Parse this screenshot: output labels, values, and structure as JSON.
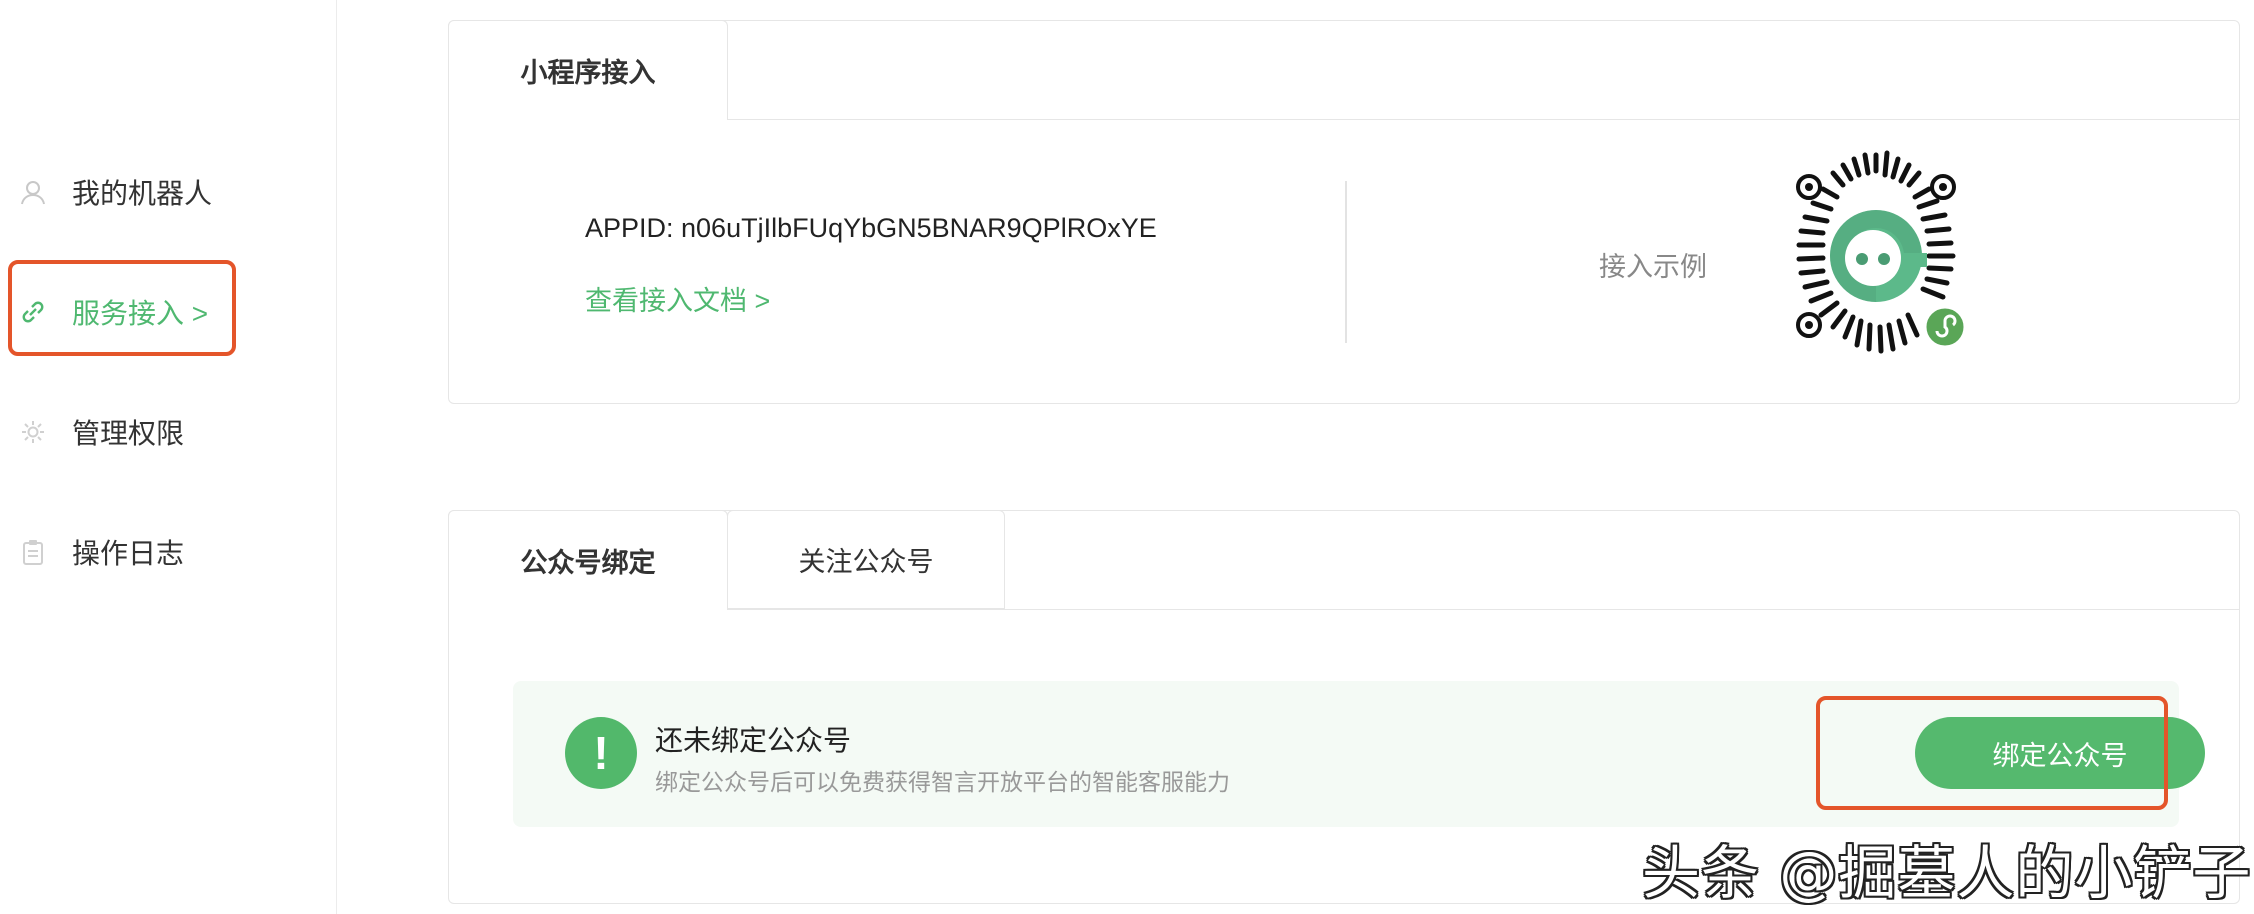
{
  "sidebar": {
    "items": [
      {
        "label": "我的机器人",
        "icon": "user-icon"
      },
      {
        "label": "服务接入 >",
        "icon": "link-icon",
        "active": true
      },
      {
        "label": "管理权限",
        "icon": "gear-icon"
      },
      {
        "label": "操作日志",
        "icon": "clipboard-icon"
      }
    ]
  },
  "miniprogram": {
    "tab": "小程序接入",
    "appid": "APPID: n06uTjIlbFUqYbGN5BNAR9QPlROxYE",
    "doc_link": "查看接入文档 >",
    "example_label": "接入示例"
  },
  "official_account": {
    "tabs": [
      "公众号绑定",
      "关注公众号"
    ],
    "notice_title": "还未绑定公众号",
    "notice_desc": "绑定公众号后可以免费获得智言开放平台的智能客服能力",
    "bind_button": "绑定公众号"
  },
  "watermark": "头条 @掘墓人的小铲子",
  "colors": {
    "accent": "#4fb870",
    "button": "#55b96e",
    "highlight": "#e4552a",
    "notice_bg": "#f4faf5"
  }
}
